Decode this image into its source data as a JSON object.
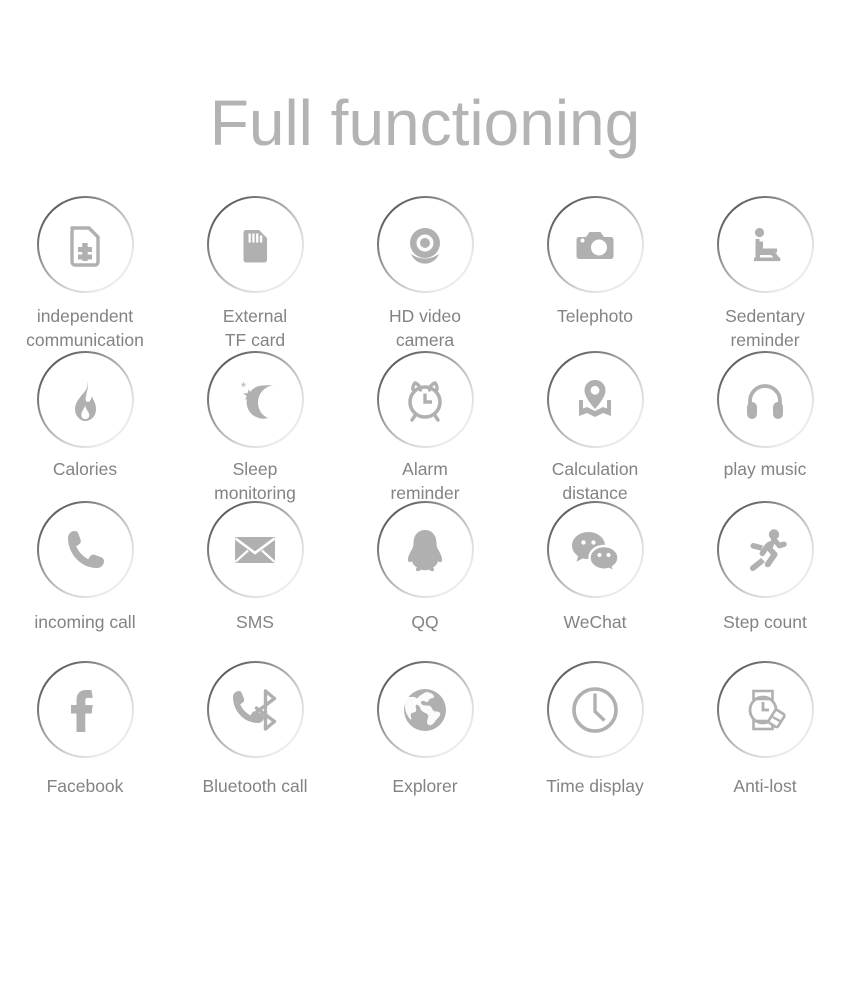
{
  "page": {
    "title": "Full functioning",
    "background_color": "#ffffff",
    "title_color": "#b3b3b3",
    "label_color": "#838383",
    "icon_color": "#b0b0b0",
    "ring_gradient_from": "#3a3a3a",
    "ring_gradient_to": "#f2f2f2"
  },
  "grid": {
    "columns": 5,
    "rows": 4,
    "features": [
      {
        "icon": "sim-card-icon",
        "label": "independent\ncommunication"
      },
      {
        "icon": "tf-memory-card-icon",
        "label": "External\nTF card"
      },
      {
        "icon": "webcam-icon",
        "label": "HD video\ncamera"
      },
      {
        "icon": "camera-icon",
        "label": "Telephoto"
      },
      {
        "icon": "sitting-person-icon",
        "label": "Sedentary\nreminder"
      },
      {
        "icon": "flame-icon",
        "label": "Calories"
      },
      {
        "icon": "crescent-moon-stars-icon",
        "label": "Sleep\nmonitoring"
      },
      {
        "icon": "alarm-clock-icon",
        "label": "Alarm\nreminder"
      },
      {
        "icon": "map-location-pin-icon",
        "label": "Calculation\ndistance"
      },
      {
        "icon": "headphones-icon",
        "label": "play music"
      },
      {
        "icon": "phone-handset-icon",
        "label": "incoming call"
      },
      {
        "icon": "envelope-icon",
        "label": "SMS"
      },
      {
        "icon": "qq-penguin-icon",
        "label": "QQ"
      },
      {
        "icon": "wechat-bubbles-icon",
        "label": "WeChat"
      },
      {
        "icon": "running-person-icon",
        "label": "Step count"
      },
      {
        "icon": "facebook-icon",
        "label": "Facebook"
      },
      {
        "icon": "bluetooth-call-icon",
        "label": "Bluetooth call"
      },
      {
        "icon": "globe-icon",
        "label": "Explorer"
      },
      {
        "icon": "clock-icon",
        "label": "Time display"
      },
      {
        "icon": "watch-phone-anti-lost-icon",
        "label": "Anti-lost"
      }
    ]
  }
}
